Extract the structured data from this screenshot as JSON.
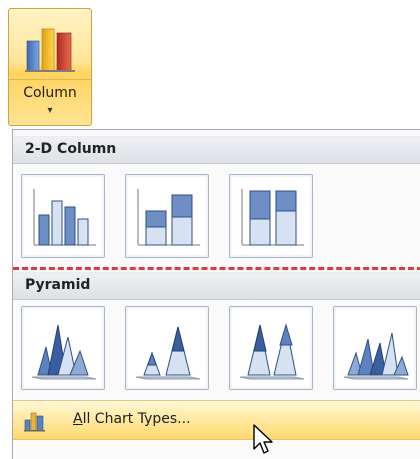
{
  "ribbon": {
    "column_button": {
      "label": "Column",
      "arrow": "▾",
      "icon": "column-chart-icon"
    }
  },
  "gallery": {
    "sections": [
      {
        "title": "2-D Column",
        "items": [
          {
            "name": "clustered-column",
            "icon": "clustered-column-icon"
          },
          {
            "name": "stacked-column",
            "icon": "stacked-column-icon"
          },
          {
            "name": "100-stacked-column",
            "icon": "100-stacked-column-icon"
          }
        ]
      },
      {
        "title": "Pyramid",
        "items": [
          {
            "name": "clustered-pyramid",
            "icon": "clustered-pyramid-icon"
          },
          {
            "name": "stacked-pyramid",
            "icon": "stacked-pyramid-icon"
          },
          {
            "name": "100-stacked-pyramid",
            "icon": "100-stacked-pyramid-icon"
          },
          {
            "name": "3d-pyramid",
            "icon": "3d-pyramid-icon"
          }
        ]
      }
    ],
    "footer": {
      "mnemonic": "A",
      "label_rest": "ll Chart Types...",
      "icon": "all-chart-types-icon"
    }
  },
  "colors": {
    "highlight_top": "#fff3c6",
    "highlight_bottom": "#ffd35e",
    "dashed_line": "#e0383c",
    "bar_blue": "#5d82c0"
  }
}
